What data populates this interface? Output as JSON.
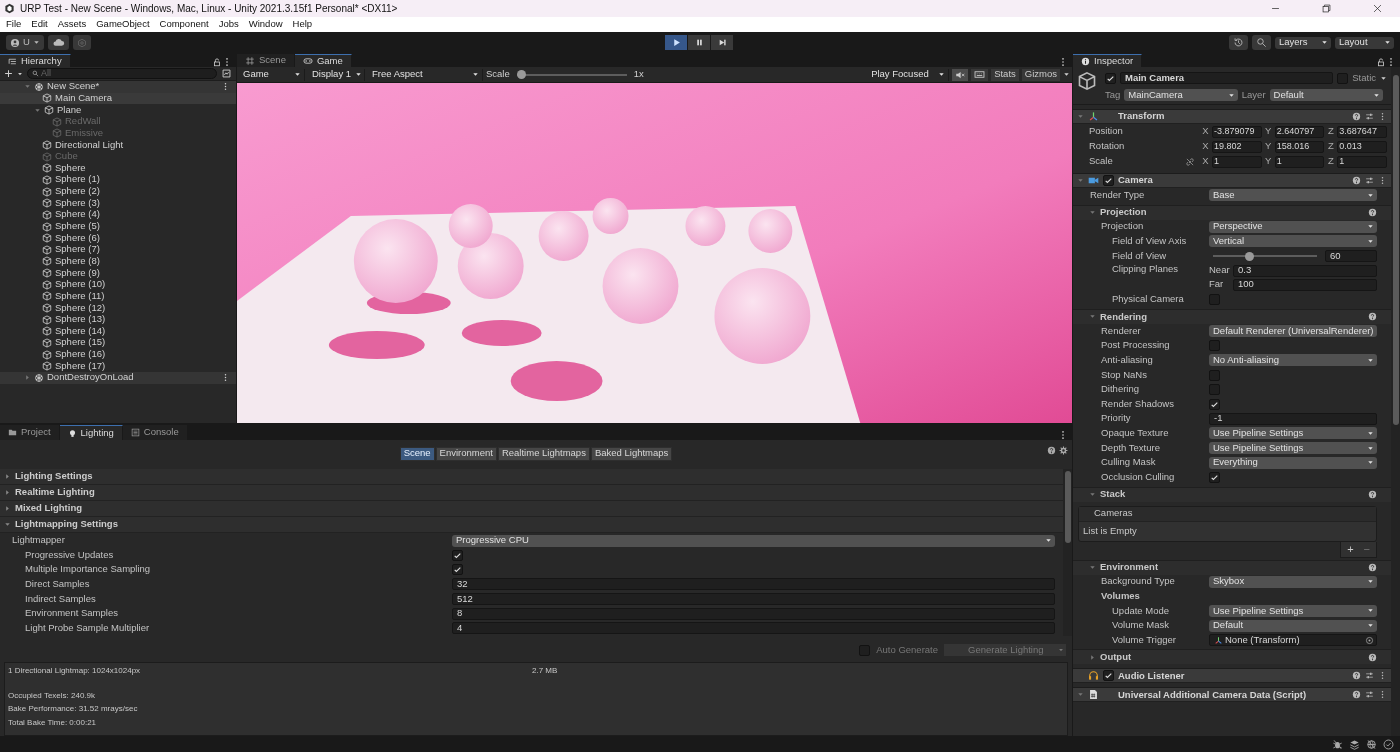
{
  "window": {
    "title": "URP Test - New Scene - Windows, Mac, Linux - Unity 2021.3.15f1 Personal* <DX11>"
  },
  "menu": [
    "File",
    "Edit",
    "Assets",
    "GameObject",
    "Component",
    "Jobs",
    "Window",
    "Help"
  ],
  "toolbar": {
    "account": "U",
    "playing": true,
    "paused": false,
    "layers": "Layers",
    "layout": "Layout"
  },
  "hierarchy": {
    "title": "Hierarchy",
    "search_placeholder": "All",
    "scenes": [
      {
        "name": "New Scene*",
        "expanded": true,
        "children": [
          {
            "name": "Main Camera",
            "active": true,
            "selected": true
          },
          {
            "name": "Plane",
            "active": true,
            "selected": false,
            "expanded": true,
            "children": [
              {
                "name": "RedWall",
                "active": false,
                "selected": false
              },
              {
                "name": "Emissive",
                "active": false,
                "selected": false
              }
            ]
          },
          {
            "name": "Directional Light",
            "active": true,
            "selected": false
          },
          {
            "name": "Cube",
            "active": false,
            "selected": false
          },
          {
            "name": "Sphere",
            "active": true,
            "selected": false
          },
          {
            "name": "Sphere (1)",
            "active": true,
            "selected": false
          },
          {
            "name": "Sphere (2)",
            "active": true,
            "selected": false
          },
          {
            "name": "Sphere (3)",
            "active": true,
            "selected": false
          },
          {
            "name": "Sphere (4)",
            "active": true,
            "selected": false
          },
          {
            "name": "Sphere (5)",
            "active": true,
            "selected": false
          },
          {
            "name": "Sphere (6)",
            "active": true,
            "selected": false
          },
          {
            "name": "Sphere (7)",
            "active": true,
            "selected": false
          },
          {
            "name": "Sphere (8)",
            "active": true,
            "selected": false
          },
          {
            "name": "Sphere (9)",
            "active": true,
            "selected": false
          },
          {
            "name": "Sphere (10)",
            "active": true,
            "selected": false
          },
          {
            "name": "Sphere (11)",
            "active": true,
            "selected": false
          },
          {
            "name": "Sphere (12)",
            "active": true,
            "selected": false
          },
          {
            "name": "Sphere (13)",
            "active": true,
            "selected": false
          },
          {
            "name": "Sphere (14)",
            "active": true,
            "selected": false
          },
          {
            "name": "Sphere (15)",
            "active": true,
            "selected": false
          },
          {
            "name": "Sphere (16)",
            "active": true,
            "selected": false
          },
          {
            "name": "Sphere (17)",
            "active": true,
            "selected": false
          }
        ]
      },
      {
        "name": "DontDestroyOnLoad",
        "expanded": false
      }
    ]
  },
  "game": {
    "tabs": [
      {
        "label": "Scene",
        "selected": false
      },
      {
        "label": "Game",
        "selected": true
      }
    ],
    "view": "Game",
    "display": "Display 1",
    "aspect": "Free Aspect",
    "scale_label": "Scale",
    "scale": {
      "level": 0
    },
    "scale_value": "1x",
    "play_mode": "Play Focused",
    "mute_audio": true,
    "stats": "Stats",
    "gizmos": "Gizmos"
  },
  "lighting_panel": {
    "tabs": [
      {
        "label": "Project",
        "selected": false
      },
      {
        "label": "Lighting",
        "selected": true
      },
      {
        "label": "Console",
        "selected": false
      }
    ],
    "views": [
      {
        "label": "Scene",
        "selected": true
      },
      {
        "label": "Environment",
        "selected": false
      },
      {
        "label": "Realtime Lightmaps",
        "selected": false
      },
      {
        "label": "Baked Lightmaps",
        "selected": false
      }
    ],
    "sections": [
      {
        "title": "Lighting Settings",
        "expanded": false
      },
      {
        "title": "Realtime Lighting",
        "expanded": false
      },
      {
        "title": "Mixed Lighting",
        "expanded": false
      },
      {
        "title": "Lightmapping Settings",
        "expanded": true,
        "fields": [
          {
            "kind": "dropdown",
            "label": "Lightmapper",
            "value": "Progressive CPU",
            "children": [
              {
                "kind": "checkbox",
                "label": "Progressive Updates",
                "checked": true
              },
              {
                "kind": "checkbox",
                "label": "Multiple Importance Sampling",
                "checked": true
              },
              {
                "kind": "text",
                "label": "Direct Samples",
                "value": "32"
              },
              {
                "kind": "text",
                "label": "Indirect Samples",
                "value": "512"
              },
              {
                "kind": "text",
                "label": "Environment Samples",
                "value": "8"
              },
              {
                "kind": "text",
                "label": "Light Probe Sample Multiplier",
                "value": "4"
              }
            ]
          }
        ]
      }
    ],
    "auto_generate": {
      "label": "Auto Generate",
      "checked": false
    },
    "generate": {
      "label": "Generate Lighting",
      "disabled": true
    },
    "stats": {
      "lightmaps": "1 Directional Lightmap: 1024x1024px",
      "size": "2.7 MB",
      "lines": [
        "Occupied Texels: 240.9k",
        "Bake Performance: 31.52 mrays/sec",
        "Total Bake Time: 0:00:21"
      ]
    }
  },
  "inspector": {
    "title": "Inspector",
    "object": {
      "active": true,
      "name": "Main Camera",
      "static": false,
      "static_label": "Static",
      "tag_label": "Tag",
      "tag": "MainCamera",
      "layer_label": "Layer",
      "layer": "Default"
    },
    "components": [
      {
        "kind": "transform",
        "title": "Transform",
        "expanded": true,
        "rows": [
          {
            "label": "Position",
            "values": [
              {
                "axis": "X",
                "value": "-3.879079"
              },
              {
                "axis": "Y",
                "value": "2.640797"
              },
              {
                "axis": "Z",
                "value": "3.687647"
              }
            ]
          },
          {
            "label": "Rotation",
            "values": [
              {
                "axis": "X",
                "value": "19.802"
              },
              {
                "axis": "Y",
                "value": "158.016"
              },
              {
                "axis": "Z",
                "value": "0.013"
              }
            ]
          },
          {
            "label": "Scale",
            "constrained": false,
            "values": [
              {
                "axis": "X",
                "value": "1"
              },
              {
                "axis": "Y",
                "value": "1"
              },
              {
                "axis": "Z",
                "value": "1"
              }
            ]
          }
        ]
      },
      {
        "kind": "camera",
        "title": "Camera",
        "enabled": true,
        "expanded": true,
        "fields": [
          {
            "kind": "dropdown",
            "label": "Render Type",
            "value": "Base"
          }
        ],
        "groups": [
          {
            "title": "Projection",
            "expanded": true,
            "fields": [
              {
                "kind": "dropdown",
                "label": "Projection",
                "value": "Perspective",
                "children": [
                  {
                    "kind": "dropdown",
                    "label": "Field of View Axis",
                    "value": "Vertical"
                  },
                  {
                    "kind": "slider",
                    "label": "Field of View",
                    "level": 0.34,
                    "value": "60"
                  },
                  {
                    "kind": "clipping",
                    "label": "Clipping Planes",
                    "near_label": "Near",
                    "near": "0.3",
                    "far_label": "Far",
                    "far": "100"
                  },
                  {
                    "kind": "checkbox",
                    "label": "Physical Camera",
                    "checked": false
                  }
                ]
              }
            ]
          },
          {
            "title": "Rendering",
            "expanded": true,
            "fields": [
              {
                "kind": "dropdown",
                "label": "Renderer",
                "value": "Default Renderer (UniversalRenderer)"
              },
              {
                "kind": "checkbox",
                "label": "Post Processing",
                "checked": false
              },
              {
                "kind": "dropdown",
                "label": "Anti-aliasing",
                "value": "No Anti-aliasing"
              },
              {
                "kind": "checkbox",
                "label": "Stop NaNs",
                "checked": false
              },
              {
                "kind": "checkbox",
                "label": "Dithering",
                "checked": false
              },
              {
                "kind": "checkbox",
                "label": "Render Shadows",
                "checked": true
              },
              {
                "kind": "text",
                "label": "Priority",
                "value": "-1"
              },
              {
                "kind": "dropdown",
                "label": "Opaque Texture",
                "value": "Use Pipeline Settings"
              },
              {
                "kind": "dropdown",
                "label": "Depth Texture",
                "value": "Use Pipeline Settings"
              },
              {
                "kind": "dropdown",
                "label": "Culling Mask",
                "value": "Everything"
              },
              {
                "kind": "checkbox",
                "label": "Occlusion Culling",
                "checked": true
              }
            ]
          },
          {
            "title": "Stack",
            "expanded": true,
            "list": {
              "header": "Cameras",
              "empty": "List is Empty",
              "add": "+",
              "remove": "−"
            }
          },
          {
            "title": "Environment",
            "expanded": true,
            "fields": [
              {
                "kind": "dropdown",
                "label": "Background Type",
                "value": "Skybox"
              },
              {
                "kind": "label",
                "label": "Volumes",
                "children": [
                  {
                    "kind": "dropdown",
                    "label": "Update Mode",
                    "value": "Use Pipeline Settings"
                  },
                  {
                    "kind": "dropdown",
                    "label": "Volume Mask",
                    "value": "Default"
                  },
                  {
                    "kind": "object",
                    "label": "Volume Trigger",
                    "value": "None (Transform)"
                  }
                ]
              }
            ]
          },
          {
            "title": "Output",
            "expanded": false
          }
        ]
      },
      {
        "kind": "audio_listener",
        "title": "Audio Listener",
        "enabled": true
      },
      {
        "kind": "script",
        "title": "Universal Additional Camera Data (Script)",
        "expanded": true
      }
    ]
  }
}
